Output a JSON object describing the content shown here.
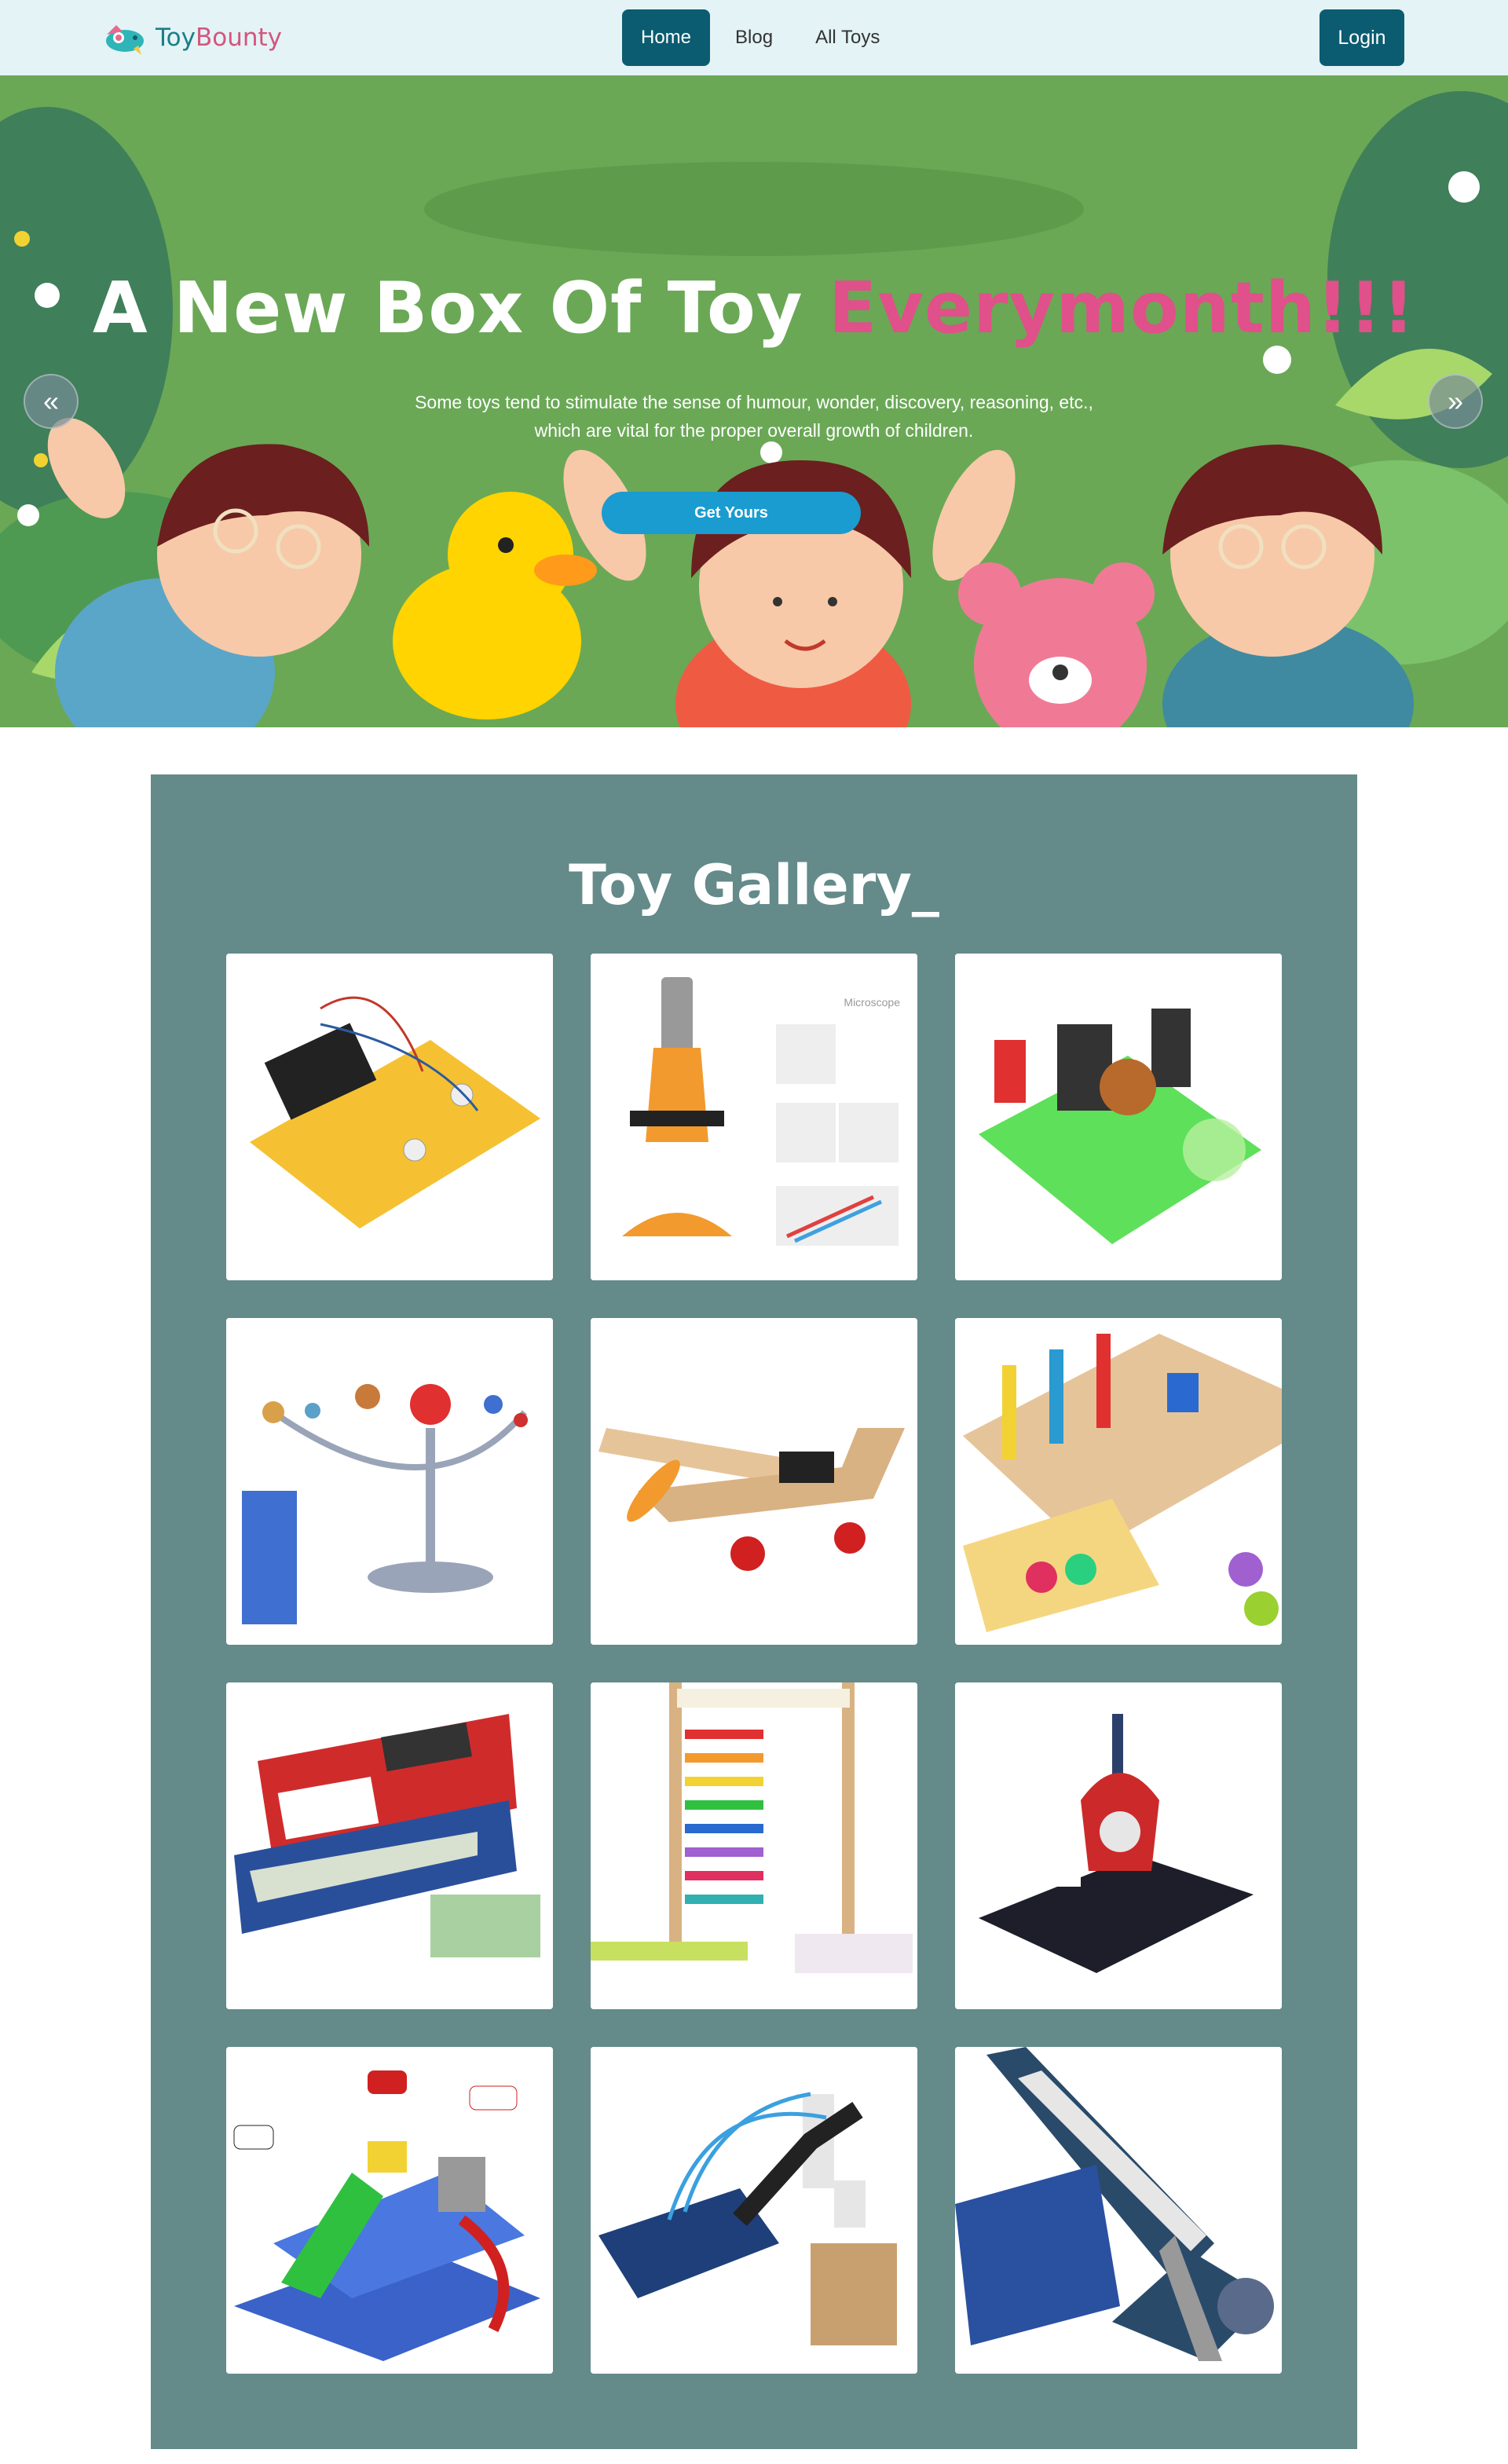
{
  "brand": {
    "part1": "Toy",
    "part2": "Bounty"
  },
  "nav": {
    "items": [
      {
        "label": "Home",
        "active": true
      },
      {
        "label": "Blog",
        "active": false
      },
      {
        "label": "All Toys",
        "active": false
      }
    ],
    "login_label": "Login"
  },
  "hero": {
    "title_main": "A New Box Of Toy ",
    "title_accent": "Everymonth!!!",
    "subtitle_line1": "Some toys tend to stimulate the sense of humour, wonder, discovery, reasoning, etc.,",
    "subtitle_line2": "which are vital for the proper overall growth of children.",
    "button_label": "Get Yours",
    "prev_icon": "chevron-double-left-icon",
    "next_icon": "chevron-double-right-icon"
  },
  "gallery": {
    "title": "Toy Gallery_",
    "items": [
      {
        "name": "circuit-kit"
      },
      {
        "name": "microscope",
        "label": "Microscope"
      },
      {
        "name": "electric-motor"
      },
      {
        "name": "solar-system-model"
      },
      {
        "name": "wooden-airplane"
      },
      {
        "name": "math-counting-toy"
      },
      {
        "name": "cash-register"
      },
      {
        "name": "abacus"
      },
      {
        "name": "magnet-motor"
      },
      {
        "name": "car-race-track"
      },
      {
        "name": "hydraulic-robot-arm"
      },
      {
        "name": "telescope-kit"
      }
    ]
  },
  "colors": {
    "navbar_bg": "#e3f3f6",
    "primary": "#0b5c70",
    "accent_pink": "#e0508a",
    "hero_button": "#1a9cd0",
    "gallery_bg": "#648a8a"
  }
}
